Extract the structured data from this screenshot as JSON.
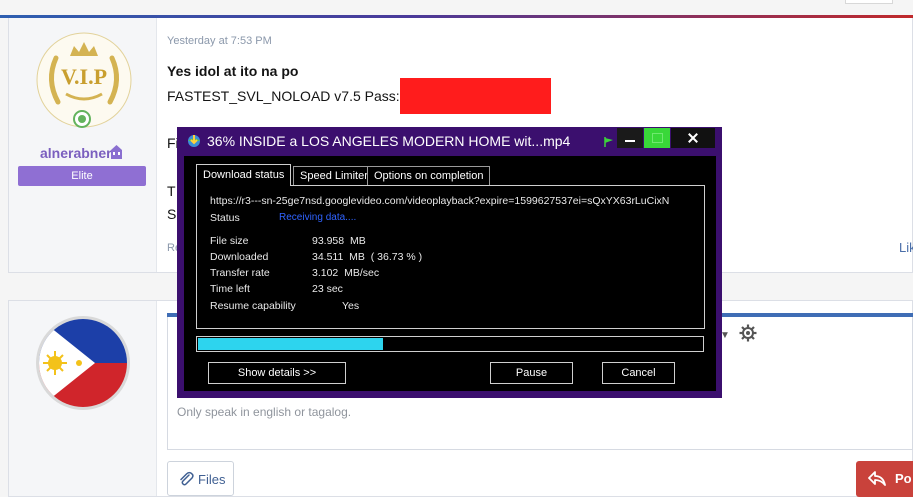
{
  "post": {
    "time": "Yesterday at 7:53 PM",
    "line1": "Yes idol at ito na po",
    "line2": "FASTEST_SVL_NOLOAD v7.5 Pass:",
    "frag_fi": "Fi",
    "frag_t": "T",
    "frag_s": "S",
    "frag_re": "Re",
    "frag_like": "Lik"
  },
  "user": {
    "username": "alnerabner",
    "badge": "Elite",
    "avatar_text": "V.I.P"
  },
  "reply": {
    "placeholder": "Only speak in english or tagalog.",
    "files_label": "Files",
    "post_label": "Po"
  },
  "dialog": {
    "title": "36% INSIDE a LOS ANGELES MODERN HOME wit...mp4",
    "tabs": [
      "Download status",
      "Speed Limiter",
      "Options on completion"
    ],
    "url": "https://r3---sn-25ge7nsd.googlevideo.com/videoplayback?expire=1599627537ei=sQxYX63rLuCixN",
    "status_label": "Status",
    "status_value": "Receiving data....",
    "rows": [
      {
        "label": "File size",
        "value": "93.958  MB"
      },
      {
        "label": "Downloaded",
        "value": "34.511  MB  ( 36.73 % )"
      },
      {
        "label": "Transfer rate",
        "value": "3.102  MB/sec"
      },
      {
        "label": "Time left",
        "value": "23 sec"
      },
      {
        "label": "Resume capability",
        "value": "Yes"
      }
    ],
    "progress_fraction": 0.3673,
    "buttons": {
      "show_details": "Show details >>",
      "pause": "Pause",
      "cancel": "Cancel"
    }
  },
  "colors": {
    "dialog_bg": "#3b0f6e",
    "progress": "#2dd4ee",
    "username": "#7b5fbf",
    "badge": "#8f6fd3",
    "redaction": "#ff1c1c",
    "post_button": "#c9423b"
  }
}
